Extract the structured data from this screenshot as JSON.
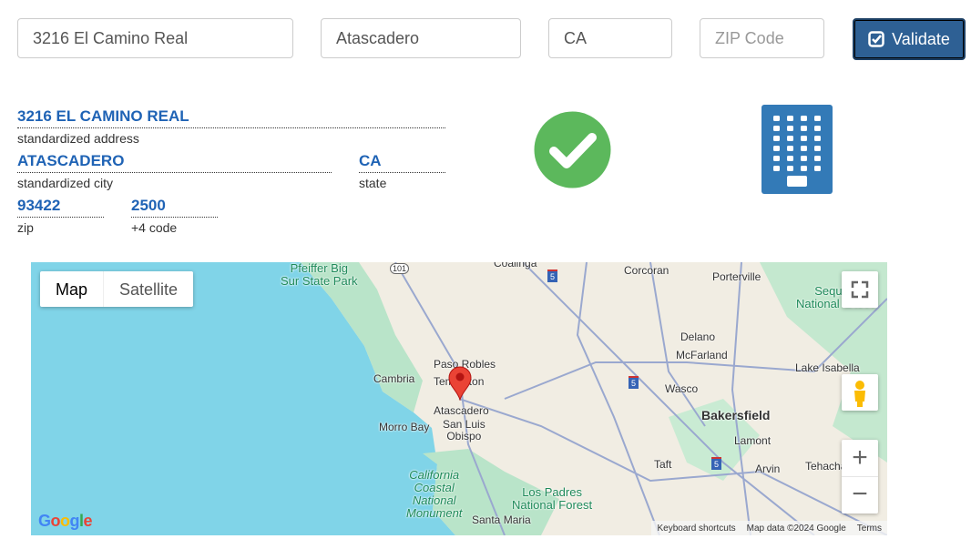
{
  "form": {
    "address": "3216 El Camino Real",
    "city": "Atascadero",
    "state": "CA",
    "zip_placeholder": "ZIP Code",
    "zip": "",
    "validate_label": "Validate"
  },
  "result": {
    "address": {
      "value": "3216 EL CAMINO REAL",
      "label": "standardized address"
    },
    "city": {
      "value": "ATASCADERO",
      "label": "standardized city"
    },
    "state": {
      "value": "CA",
      "label": "state"
    },
    "zip": {
      "value": "93422",
      "label": "zip"
    },
    "plus4": {
      "value": "2500",
      "label": "+4 code"
    },
    "status_icon": "check-circle",
    "status_color": "#5cb85c",
    "building_icon": "building",
    "building_color": "#337ab7"
  },
  "map": {
    "type_buttons": [
      "Map",
      "Satellite"
    ],
    "selected": "Map",
    "labels": {
      "pfeiffer": "Pfeiffer Big\nSur State Park",
      "coalinga": "Coalinga",
      "corcoran": "Corcoran",
      "porterville": "Porterville",
      "sequoia": "Sequoia\nNational Forest",
      "delano": "Delano",
      "mcfarland": "McFarland",
      "paso": "Paso Robles",
      "templeton": "Templeton",
      "cambria": "Cambria",
      "wasco": "Wasco",
      "lake": "Lake Isabella",
      "atascadero": "Atascadero",
      "morro": "Morro Bay",
      "slo": "San Luis\nObispo",
      "bakersfield": "Bakersfield",
      "lamont": "Lamont",
      "taft": "Taft",
      "arvin": "Arvin",
      "tehachapi": "Tehachapi",
      "coastal": "California\nCoastal\nNational\nMonument",
      "padres": "Los Padres\nNational Forest",
      "santamaria": "Santa Maria",
      "hwy101": "101",
      "i5": "5"
    },
    "footer": {
      "shortcuts": "Keyboard shortcuts",
      "data": "Map data ©2024 Google",
      "terms": "Terms"
    },
    "logo": "Google"
  }
}
